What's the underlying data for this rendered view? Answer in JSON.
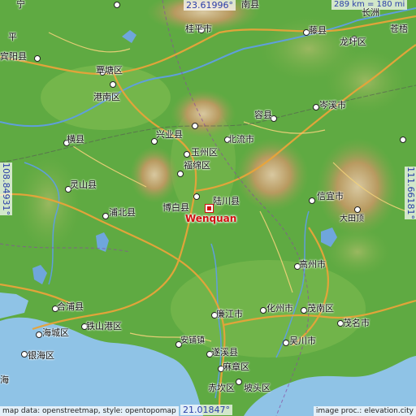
{
  "place": "Wenquan",
  "coords": {
    "top": "23.61996°",
    "bottom": "21.01847°",
    "left": "108.84931°",
    "right": "111.66181°"
  },
  "scale": "289 km = 180 mi",
  "credits": {
    "left": "map data: openstreetmap, style: opentopomap",
    "right": "image proc.: elevation.city"
  },
  "labels": {
    "nanxian": "南县",
    "zhangchuan": "长洲",
    "guiping": "桂平市",
    "tengxian": "藤县",
    "longxu": "龙圩区",
    "cangwu": "苍梧",
    "binyang": "宾阳县",
    "zhangtang": "覃塘区",
    "gangnan": "港南区",
    "cenxi": "岑溪市",
    "rongxian": "容县",
    "xingye": "兴业县",
    "beiliu": "北流市",
    "hengxian": "横县",
    "yuzhou": "玉州区",
    "fumian": "福绵区",
    "lingshan": "灵山县",
    "bobai": "博白县",
    "luchuan": "陆川县",
    "xinyi": "信宜市",
    "pubei": "浦北县",
    "dadingding": "大田顶",
    "gaozhou": "高州市",
    "hepu": "合浦县",
    "huazhou": "化州市",
    "maonan": "茂南区",
    "lianjiang": "廉江市",
    "tieshan": "铁山港区",
    "haicheng": "海城区",
    "yinhai": "银海区",
    "maoming": "茂名市",
    "wuchuan": "吴川市",
    "anpu": "安铺镇",
    "suixi": "遂溪县",
    "mazhang": "麻章区",
    "chikan": "赤坎区",
    "potou": "坡头区",
    "partial": "宁",
    "aux": "平",
    "yinhai2": "海"
  }
}
